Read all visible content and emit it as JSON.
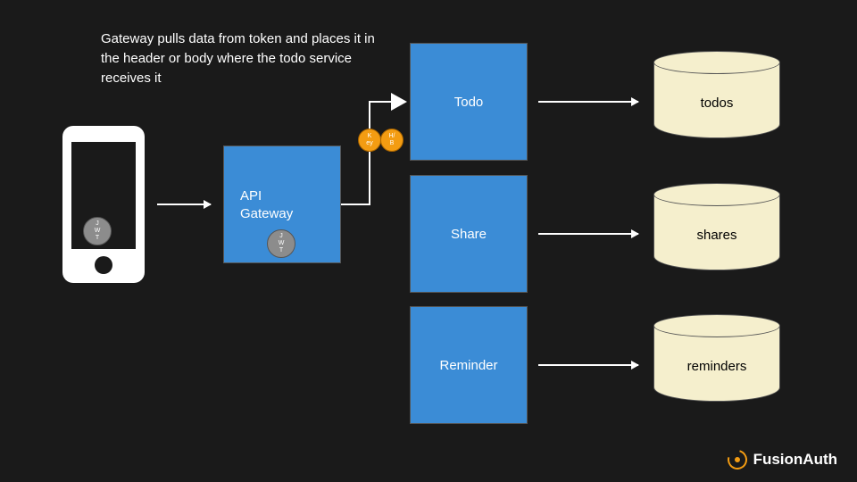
{
  "caption": "Gateway pulls data from token and places it in the header or body where the todo service receives it",
  "phone": {
    "jwt": "J\nW\nT"
  },
  "gateway": {
    "label": "API\nGateway",
    "jwt": "J\nW\nT"
  },
  "badges": {
    "key": "K\ney",
    "hb": "H/\nB"
  },
  "services": [
    {
      "label": "Todo"
    },
    {
      "label": "Share"
    },
    {
      "label": "Reminder"
    }
  ],
  "databases": [
    {
      "label": "todos"
    },
    {
      "label": "shares"
    },
    {
      "label": "reminders"
    }
  ],
  "brand": {
    "name": "FusionAuth"
  },
  "colors": {
    "bg": "#1a1a1a",
    "box": "#3b8cd6",
    "cylinder": "#F5EFCD",
    "badge_orange": "#f39c12",
    "badge_gray": "#8c8c8c"
  }
}
